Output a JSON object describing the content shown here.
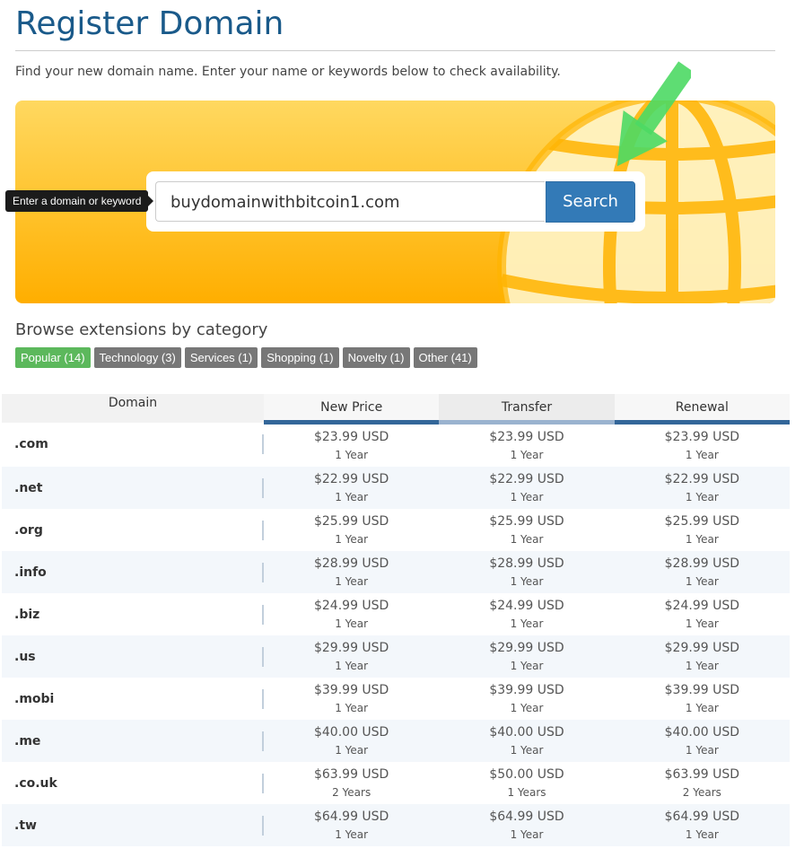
{
  "page": {
    "title": "Register Domain",
    "subtitle": "Find your new domain name. Enter your name or keywords below to check availability."
  },
  "search": {
    "tooltip": "Enter a domain or keyword",
    "value": "buydomainwithbitcoin1.com",
    "button_label": "Search"
  },
  "colors": {
    "title": "#1a5a8a",
    "search_button": "#337ab7",
    "banner_top": "#ffd860",
    "banner_bottom": "#ffae00",
    "active_category": "#5cb85c",
    "category": "#777777",
    "arrow": "#4cd964"
  },
  "icons": [
    "globe-icon",
    "arrow-icon"
  ],
  "browse": {
    "title": "Browse extensions by category",
    "categories": [
      {
        "label": "Popular (14)",
        "active": true
      },
      {
        "label": "Technology (3)",
        "active": false
      },
      {
        "label": "Services (1)",
        "active": false
      },
      {
        "label": "Shopping (1)",
        "active": false
      },
      {
        "label": "Novelty (1)",
        "active": false
      },
      {
        "label": "Other (41)",
        "active": false
      }
    ]
  },
  "table": {
    "headers": {
      "domain": "Domain",
      "new_price": "New Price",
      "transfer": "Transfer",
      "renewal": "Renewal"
    },
    "rows": [
      {
        "tld": ".com",
        "new": "$23.99 USD",
        "new_p": "1 Year",
        "transfer": "$23.99 USD",
        "transfer_p": "1 Year",
        "renewal": "$23.99 USD",
        "renewal_p": "1 Year"
      },
      {
        "tld": ".net",
        "new": "$22.99 USD",
        "new_p": "1 Year",
        "transfer": "$22.99 USD",
        "transfer_p": "1 Year",
        "renewal": "$22.99 USD",
        "renewal_p": "1 Year"
      },
      {
        "tld": ".org",
        "new": "$25.99 USD",
        "new_p": "1 Year",
        "transfer": "$25.99 USD",
        "transfer_p": "1 Year",
        "renewal": "$25.99 USD",
        "renewal_p": "1 Year"
      },
      {
        "tld": ".info",
        "new": "$28.99 USD",
        "new_p": "1 Year",
        "transfer": "$28.99 USD",
        "transfer_p": "1 Year",
        "renewal": "$28.99 USD",
        "renewal_p": "1 Year"
      },
      {
        "tld": ".biz",
        "new": "$24.99 USD",
        "new_p": "1 Year",
        "transfer": "$24.99 USD",
        "transfer_p": "1 Year",
        "renewal": "$24.99 USD",
        "renewal_p": "1 Year"
      },
      {
        "tld": ".us",
        "new": "$29.99 USD",
        "new_p": "1 Year",
        "transfer": "$29.99 USD",
        "transfer_p": "1 Year",
        "renewal": "$29.99 USD",
        "renewal_p": "1 Year"
      },
      {
        "tld": ".mobi",
        "new": "$39.99 USD",
        "new_p": "1 Year",
        "transfer": "$39.99 USD",
        "transfer_p": "1 Year",
        "renewal": "$39.99 USD",
        "renewal_p": "1 Year"
      },
      {
        "tld": ".me",
        "new": "$40.00 USD",
        "new_p": "1 Year",
        "transfer": "$40.00 USD",
        "transfer_p": "1 Year",
        "renewal": "$40.00 USD",
        "renewal_p": "1 Year"
      },
      {
        "tld": ".co.uk",
        "new": "$63.99 USD",
        "new_p": "2 Years",
        "transfer": "$50.00 USD",
        "transfer_p": "1 Years",
        "renewal": "$63.99 USD",
        "renewal_p": "2 Years"
      },
      {
        "tld": ".tw",
        "new": "$64.99 USD",
        "new_p": "1 Year",
        "transfer": "$64.99 USD",
        "transfer_p": "1 Year",
        "renewal": "$64.99 USD",
        "renewal_p": "1 Year"
      }
    ]
  }
}
